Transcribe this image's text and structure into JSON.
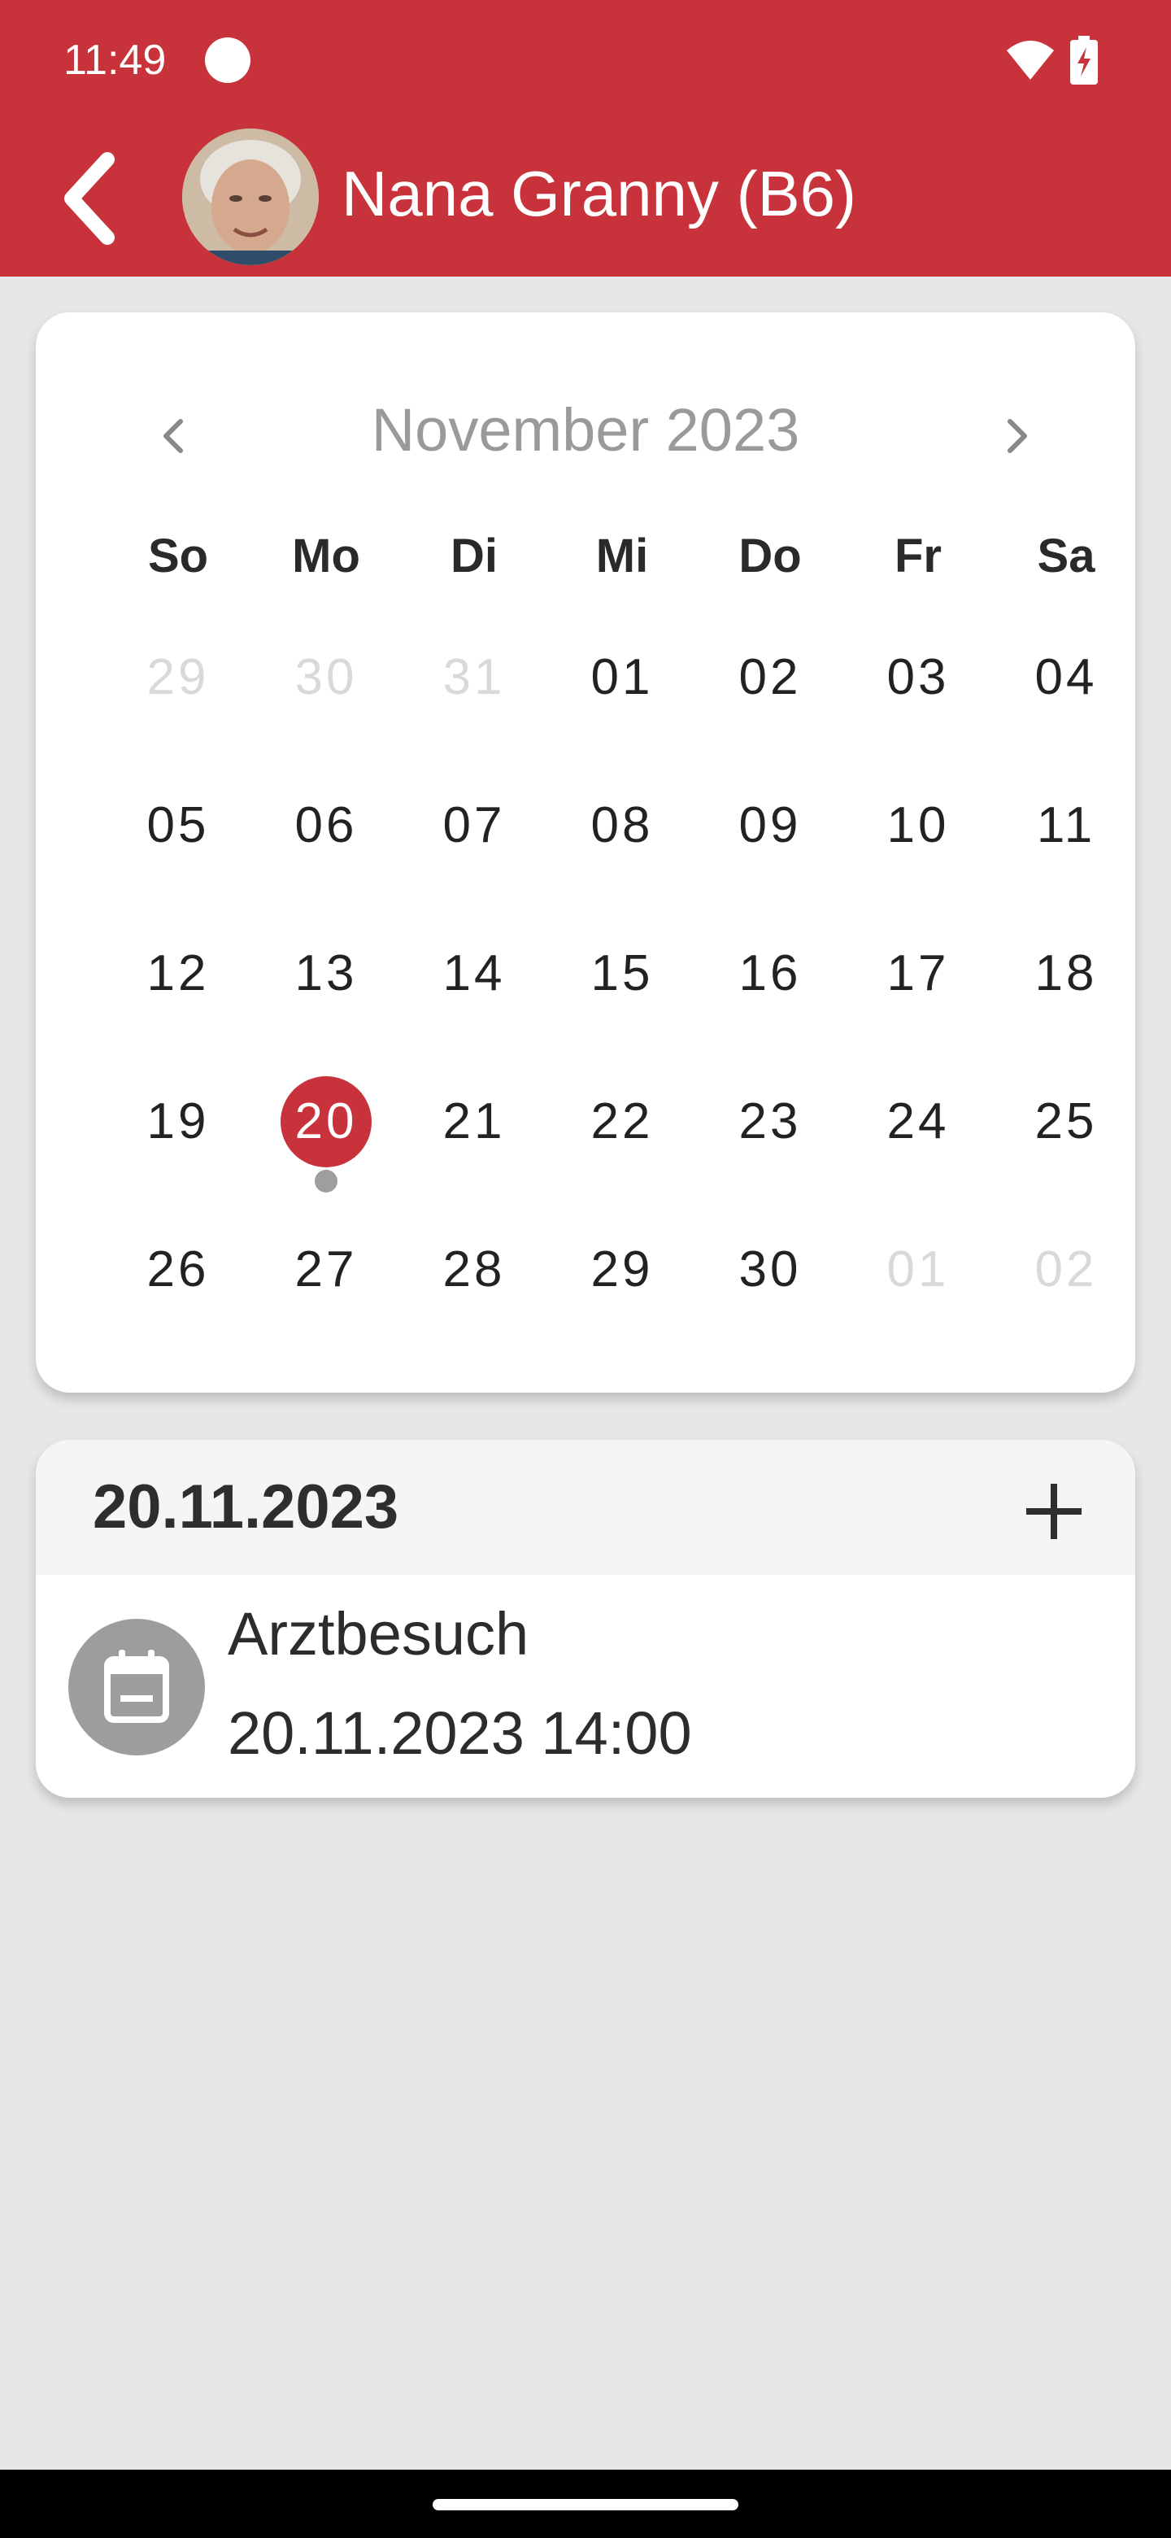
{
  "status_bar": {
    "time": "11:49"
  },
  "header": {
    "title": "Nana Granny (B6)"
  },
  "calendar": {
    "month_label": "November 2023",
    "weekdays": [
      "So",
      "Mo",
      "Di",
      "Mi",
      "Do",
      "Fr",
      "Sa"
    ],
    "weeks": [
      [
        {
          "d": "29",
          "muted": true
        },
        {
          "d": "30",
          "muted": true
        },
        {
          "d": "31",
          "muted": true
        },
        {
          "d": "01"
        },
        {
          "d": "02"
        },
        {
          "d": "03"
        },
        {
          "d": "04"
        }
      ],
      [
        {
          "d": "05"
        },
        {
          "d": "06"
        },
        {
          "d": "07"
        },
        {
          "d": "08"
        },
        {
          "d": "09"
        },
        {
          "d": "10"
        },
        {
          "d": "11"
        }
      ],
      [
        {
          "d": "12"
        },
        {
          "d": "13"
        },
        {
          "d": "14"
        },
        {
          "d": "15"
        },
        {
          "d": "16"
        },
        {
          "d": "17"
        },
        {
          "d": "18"
        }
      ],
      [
        {
          "d": "19"
        },
        {
          "d": "20",
          "selected": true,
          "has_event": true
        },
        {
          "d": "21"
        },
        {
          "d": "22"
        },
        {
          "d": "23"
        },
        {
          "d": "24"
        },
        {
          "d": "25"
        }
      ],
      [
        {
          "d": "26"
        },
        {
          "d": "27"
        },
        {
          "d": "28"
        },
        {
          "d": "29"
        },
        {
          "d": "30"
        },
        {
          "d": "01",
          "muted": true
        },
        {
          "d": "02",
          "muted": true
        }
      ]
    ]
  },
  "events": {
    "date_label": "20.11.2023",
    "items": [
      {
        "title": "Arztbesuch",
        "datetime": "20.11.2023 14:00",
        "icon": "calendar-icon"
      }
    ]
  },
  "colors": {
    "accent": "#c8323a",
    "background": "#e6e7e9",
    "muted_day": "#d9d9d9",
    "event_dot": "#9e9e9e"
  }
}
